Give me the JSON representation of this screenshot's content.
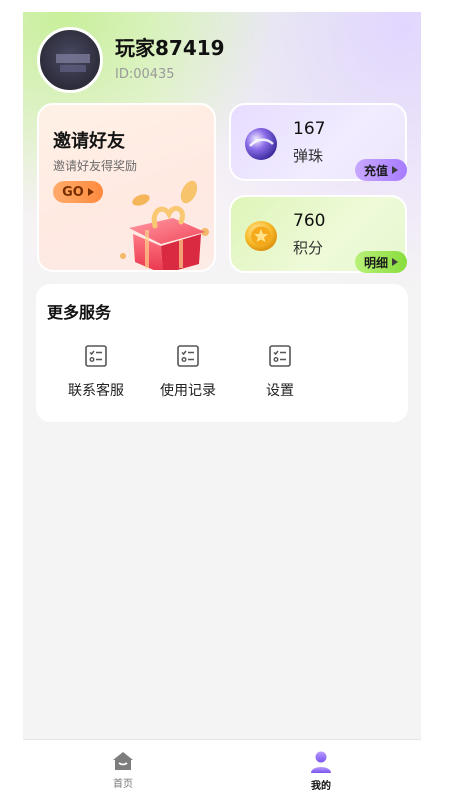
{
  "profile": {
    "username": "玩家87419",
    "user_id": "ID:00435"
  },
  "invite": {
    "title": "邀请好友",
    "subtitle": "邀请好友得奖励",
    "button_label": "GO"
  },
  "marbles": {
    "value": "167",
    "label": "弹珠",
    "button_label": "充值"
  },
  "points": {
    "value": "760",
    "label": "积分",
    "button_label": "明细"
  },
  "services": {
    "title": "更多服务",
    "items": [
      {
        "label": "联系客服",
        "icon": "checklist-icon"
      },
      {
        "label": "使用记录",
        "icon": "checklist-icon"
      },
      {
        "label": "设置",
        "icon": "checklist-icon"
      }
    ]
  },
  "tabbar": {
    "tabs": [
      {
        "label": "首页",
        "icon": "home-icon",
        "active": false
      },
      {
        "label": "我的",
        "icon": "user-icon",
        "active": true
      }
    ]
  },
  "colors": {
    "accent_purple": "#a77bff",
    "accent_green": "#88dd3c",
    "accent_orange": "#ff8a3d"
  }
}
